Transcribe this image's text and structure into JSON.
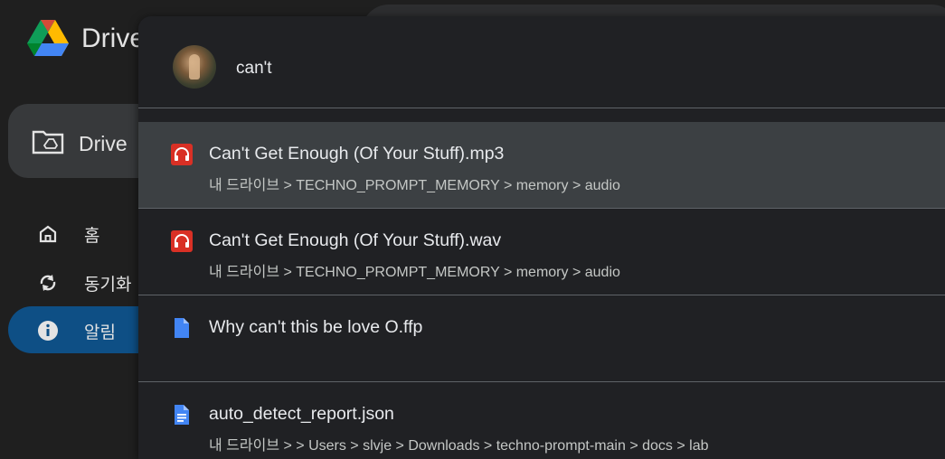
{
  "app": {
    "name": "Drive"
  },
  "sidebar": {
    "drive_label": "Drive",
    "items": [
      {
        "label": "홈",
        "icon": "home-icon"
      },
      {
        "label": "동기화",
        "icon": "sync-icon"
      },
      {
        "label": "알림",
        "icon": "info-icon",
        "active": true
      }
    ]
  },
  "search": {
    "query": "can't",
    "results": [
      {
        "name": "Can't Get Enough (Of Your Stuff).mp3",
        "path": "내 드라이브 > TECHNO_PROMPT_MEMORY > memory > audio",
        "icon": "audio-file-icon"
      },
      {
        "name": "Can't Get Enough (Of Your Stuff).wav",
        "path": "내 드라이브 > TECHNO_PROMPT_MEMORY > memory > audio",
        "icon": "audio-file-icon"
      },
      {
        "name": "Why can't this be love O.ffp",
        "path": "",
        "icon": "file-icon"
      },
      {
        "name": "auto_detect_report.json",
        "path": "내 드라이브 > > Users > slvje > Downloads > techno-prompt-main > docs > lab",
        "icon": "document-icon"
      }
    ]
  },
  "colors": {
    "background": "#1f1f1f",
    "dropdown": "#202124",
    "hover": "#3c4043",
    "active_nav": "#0e4f85",
    "audio_icon": "#d93025",
    "doc_icon": "#4285f4"
  }
}
